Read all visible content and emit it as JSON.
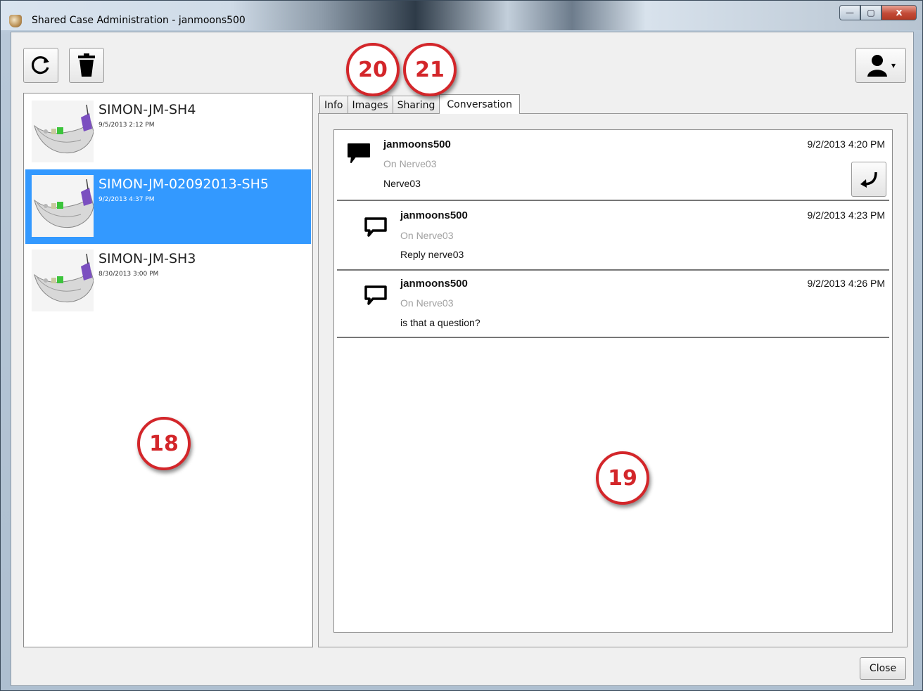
{
  "window": {
    "title": "Shared Case Administration - janmoons500",
    "minimize": "—",
    "maximize": "▢",
    "close": "x"
  },
  "toolbar": {
    "refresh_icon": "refresh-icon",
    "delete_icon": "trash-icon",
    "user_icon": "user-icon",
    "user_arrow": "▾"
  },
  "cases": [
    {
      "name": "SIMON-JM-SH4",
      "date": "9/5/2013 2:12 PM",
      "selected": false
    },
    {
      "name": "SIMON-JM-02092013-SH5",
      "date": "9/2/2013 4:37 PM",
      "selected": true
    },
    {
      "name": "SIMON-JM-SH3",
      "date": "8/30/2013 3:00 PM",
      "selected": false
    }
  ],
  "tabs": [
    "Info",
    "Images",
    "Sharing",
    "Conversation"
  ],
  "active_tab": "Conversation",
  "messages": [
    {
      "author": "janmoons500",
      "context": "On Nerve03",
      "text": "Nerve03",
      "time": "9/2/2013 4:20 PM",
      "type": "root"
    },
    {
      "author": "janmoons500",
      "context": "On Nerve03",
      "text": "Reply nerve03",
      "time": "9/2/2013 4:23 PM",
      "type": "reply"
    },
    {
      "author": "janmoons500",
      "context": "On Nerve03",
      "text": "is that a question?",
      "time": "9/2/2013 4:26 PM",
      "type": "reply"
    }
  ],
  "footer": {
    "close_label": "Close"
  },
  "callouts": [
    "18",
    "19",
    "20",
    "21"
  ],
  "colors": {
    "selection": "#3399ff",
    "callout": "#d3262a"
  }
}
